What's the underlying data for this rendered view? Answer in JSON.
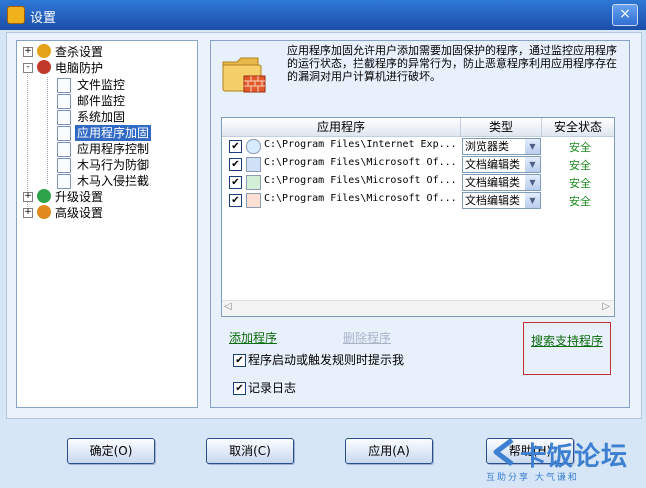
{
  "window": {
    "title": "设置",
    "close_label": "×"
  },
  "tree": {
    "items": [
      {
        "label": "查杀设置",
        "expander": "+"
      },
      {
        "label": "电脑防护",
        "expander": "-"
      },
      {
        "label": "文件监控"
      },
      {
        "label": "邮件监控"
      },
      {
        "label": "系统加固"
      },
      {
        "label": "应用程序加固"
      },
      {
        "label": "应用程序控制"
      },
      {
        "label": "木马行为防御"
      },
      {
        "label": "木马入侵拦截"
      },
      {
        "label": "升级设置",
        "expander": "+"
      },
      {
        "label": "高级设置",
        "expander": "+"
      }
    ]
  },
  "main": {
    "description": "应用程序加固允许用户添加需要加固保护的程序，通过监控应用程序的运行状态，拦截程序的异常行为，防止恶意程序利用应用程序存在的漏洞对用户计算机进行破坏。",
    "columns": [
      "应用程序",
      "类型",
      "安全状态"
    ],
    "rows": [
      {
        "path": "C:\\Program Files\\Internet Exp...",
        "type": "浏览器类",
        "status": "安全",
        "checked": "✔"
      },
      {
        "path": "C:\\Program Files\\Microsoft Of...",
        "type": "文档编辑类",
        "status": "安全",
        "checked": "✔"
      },
      {
        "path": "C:\\Program Files\\Microsoft Of...",
        "type": "文档编辑类",
        "status": "安全",
        "checked": "✔"
      },
      {
        "path": "C:\\Program Files\\Microsoft Of...",
        "type": "文档编辑类",
        "status": "安全",
        "checked": "✔"
      }
    ],
    "scroll_left": "◁",
    "scroll_right": "▷",
    "add_link": "添加程序",
    "remove_link": "删除程序",
    "search_link": "搜索支持程序",
    "notify_checkbox": "程序启动或触发规则时提示我",
    "log_checkbox": "记录日志",
    "check_mark": "✔"
  },
  "buttons": {
    "ok": "确定(O)",
    "cancel": "取消(C)",
    "apply": "应用(A)",
    "help": "帮助(H)"
  },
  "watermark": {
    "title": "卡饭论坛",
    "slogan": "互助分享  大气谦和"
  },
  "colors": {
    "titlebar": "#1c4ea9",
    "selection": "#316ac5",
    "safe": "#1e8b1e",
    "link": "#0b6c0b",
    "highlight_box": "#c23232"
  }
}
